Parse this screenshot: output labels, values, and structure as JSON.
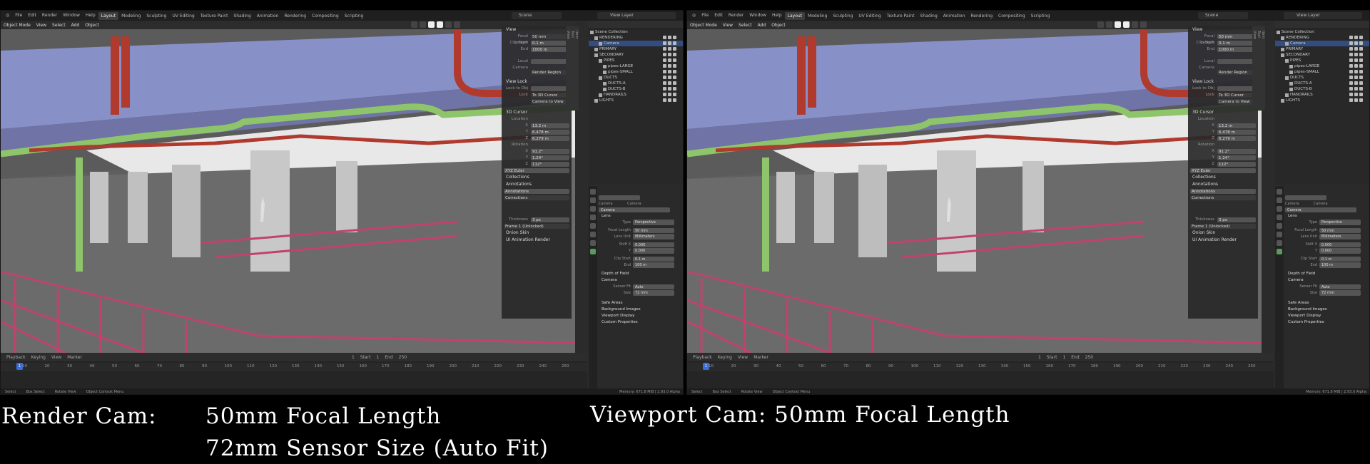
{
  "menu": [
    "File",
    "Edit",
    "Render",
    "Window",
    "Help"
  ],
  "workspaces": [
    "Layout",
    "Modeling",
    "Sculpting",
    "UV Editing",
    "Texture Paint",
    "Shading",
    "Animation",
    "Rendering",
    "Compositing",
    "Scripting"
  ],
  "scene_label": "Scene",
  "view_layer_label": "View Layer",
  "viewport_header": [
    "Object Mode",
    "View",
    "Select",
    "Add",
    "Object"
  ],
  "npanel": {
    "view_section": "View",
    "focal_length_label": "Focal Length",
    "focal_length_left": "50 mm",
    "focal_length_right": "50 mm",
    "clip_start_label": "Clip Start",
    "clip_start": "0.1 m",
    "end_label": "End",
    "clip_end": "1000 m",
    "local_camera": "Local Camera",
    "render_region": "Render Region",
    "view_lock": "View Lock",
    "lock_to_obj": "Lock to Obj",
    "lock": "Lock",
    "to_3d_cursor": "To 3D Cursor",
    "camera_to_view": "Camera to View",
    "cursor_section": "3D Cursor",
    "location": "Location",
    "loc_x": "13.2 m",
    "loc_y": "6.478 m",
    "loc_z": "6.279 m",
    "rotation": "Rotation",
    "rot_x": "91.2°",
    "rot_y": "1.24°",
    "rot_z": "112°",
    "xyz_euler": "XYZ Euler",
    "collections": "Collections",
    "annotations": "Annotations",
    "annotations_field": "Annotations",
    "corrections": "Corrections",
    "thickness_label": "Thickness",
    "thickness": "3 px",
    "frame_label": "Frame 1 (Unlocked)",
    "onion_skin": "Onion Skin",
    "ui_anim": "UI Animation Render"
  },
  "outliner": {
    "root": "Scene Collection",
    "rows": [
      "RENDERING",
      "Camera",
      "PRIMARY",
      "SECONDARY",
      "PIPES",
      "pipes-LARGE",
      "pipes-SMALL",
      "DUCTS",
      "DUCTS-A",
      "DUCTS-B",
      "HANDRAILS",
      "LIGHTS"
    ]
  },
  "properties": {
    "obj_camera": "Camera",
    "data_camera": "Camera",
    "name_field": "Camera",
    "lens": "Lens",
    "type_label": "Type",
    "type_value": "Perspective",
    "focal_label": "Focal Length",
    "focal_value": "50 mm",
    "lens_unit_label": "Lens Unit",
    "lens_unit_value": "Millimeters",
    "shift_x_label": "Shift X",
    "shift_x": "0.000",
    "shift_y_label": "Y",
    "shift_y": "0.000",
    "clip_start_label": "Clip Start",
    "clip_start": "0.1 m",
    "end_label": "End",
    "clip_end": "100 m",
    "dof": "Depth of Field",
    "camera_sec": "Camera",
    "sensor_fit_label": "Sensor Fit",
    "sensor_fit": "Auto",
    "size_label": "Size",
    "size": "72 mm",
    "safe_areas": "Safe Areas",
    "bg_images": "Background Images",
    "viewport_display": "Viewport Display",
    "custom_props": "Custom Properties"
  },
  "timeline": {
    "menus": [
      "Playback",
      "Keying",
      "View",
      "Marker"
    ],
    "current_frame": "1",
    "start_label": "Start",
    "start": "1",
    "end_label": "End",
    "end": "250",
    "ticks": [
      "10",
      "20",
      "30",
      "40",
      "50",
      "60",
      "70",
      "80",
      "90",
      "100",
      "110",
      "120",
      "130",
      "140",
      "150",
      "160",
      "170",
      "180",
      "190",
      "200",
      "210",
      "220",
      "230",
      "240",
      "250"
    ]
  },
  "status": {
    "select": "Select",
    "box_select": "Box Select",
    "rotate_view": "Rotate View",
    "context_menu": "Object Context Menu",
    "memory": "Memory: 671.8 MiB | 2.93.0 Alpha"
  },
  "captions": {
    "left_line1_a": "Render Cam:",
    "left_line1_b": "50mm Focal Length",
    "left_line2": "72mm Sensor Size (Auto Fit)",
    "right_line1": "Viewport Cam: 50mm Focal Length"
  },
  "colors": {
    "pipe_red": "#b03a2e",
    "pipe_green": "#8fc56a",
    "duct_blue": "#7c84c8",
    "handrail": "#c0426e",
    "selection": "#334d80"
  }
}
